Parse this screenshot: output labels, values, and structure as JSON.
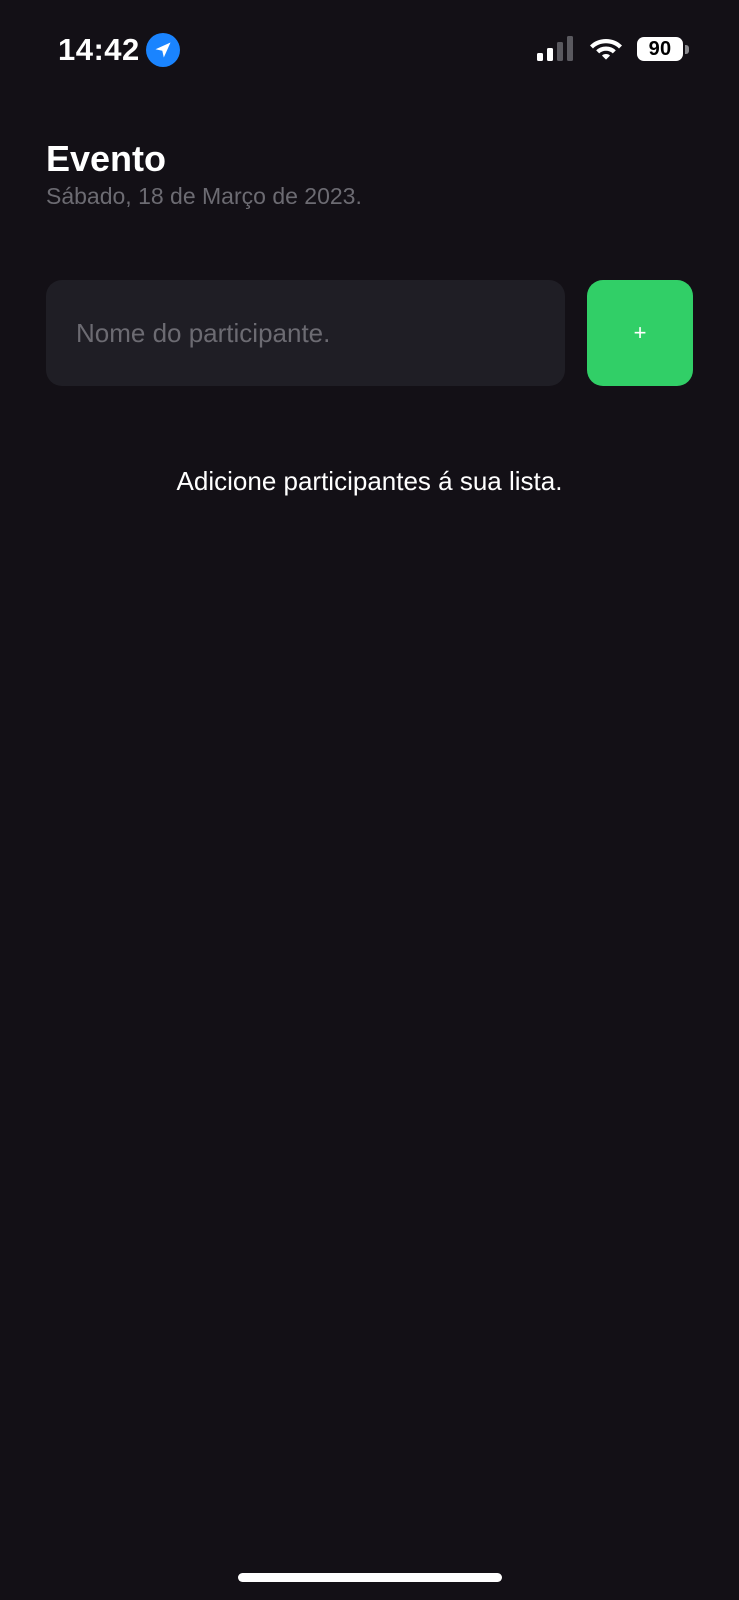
{
  "status_bar": {
    "time": "14:42",
    "battery_level": "90",
    "icons": [
      "location-arrow-icon",
      "cellular-signal-icon",
      "wifi-icon",
      "battery-icon"
    ],
    "signal_bars_active": 2,
    "signal_bars_total": 4
  },
  "header": {
    "title": "Evento",
    "subtitle": "Sábado, 18 de Março de 2023."
  },
  "form": {
    "participant_input": {
      "placeholder": "Nome do participante.",
      "value": ""
    },
    "add_button_label": "+"
  },
  "list": {
    "empty_message": "Adicione participantes á sua lista."
  },
  "colors": {
    "background": "#131016",
    "input_background": "#1f1e25",
    "accent_green": "#31cf67",
    "muted_text": "#6c6b72",
    "location_blue": "#1a84ff"
  }
}
